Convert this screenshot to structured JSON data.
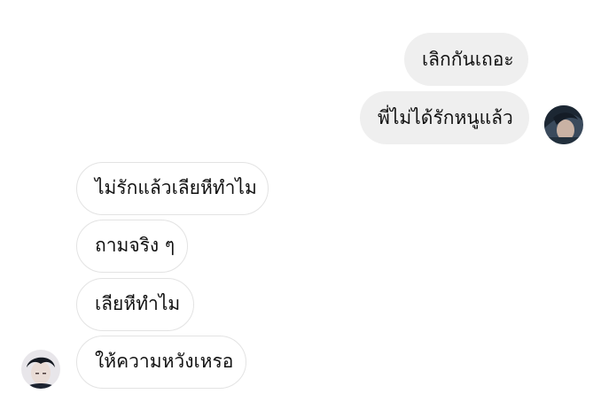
{
  "conversation": {
    "outgoing": [
      {
        "text": "เลิกกันเถอะ"
      },
      {
        "text": "พี่ไม่ได้รักหนูแล้ว"
      }
    ],
    "incoming": [
      {
        "text": "ไม่รักแล้วเลียหีทำไม"
      },
      {
        "text": "ถามจริง ๆ"
      },
      {
        "text": "เลียหีทำไม"
      },
      {
        "text": "ให้ความหวังเหรอ"
      }
    ]
  },
  "colors": {
    "outgoing_bubble": "#efefef",
    "incoming_bubble": "#ffffff",
    "incoming_border": "#e3e3e3",
    "text": "#111111"
  },
  "avatars": {
    "outgoing": "sender-avatar",
    "incoming": "receiver-avatar"
  }
}
